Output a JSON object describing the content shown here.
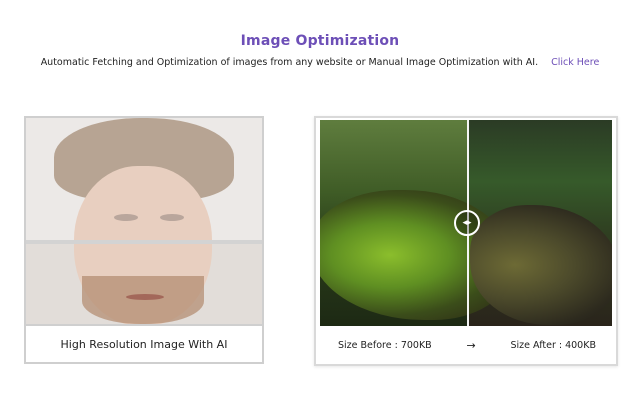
{
  "header": {
    "title": "Image Optimization",
    "subtitle": "Automatic Fetching and Optimization of images from any website or Manual Image Optimization with AI.",
    "link_label": "Click Here"
  },
  "left_card": {
    "label": "High Resolution Image With AI"
  },
  "right_card": {
    "size_before": "Size Before : 700KB",
    "arrow": "→",
    "size_after": "Size After : 400KB",
    "handle_icon": "◂▸"
  },
  "colors": {
    "accent": "#6d4fb7",
    "border": "#cfcfcf"
  }
}
